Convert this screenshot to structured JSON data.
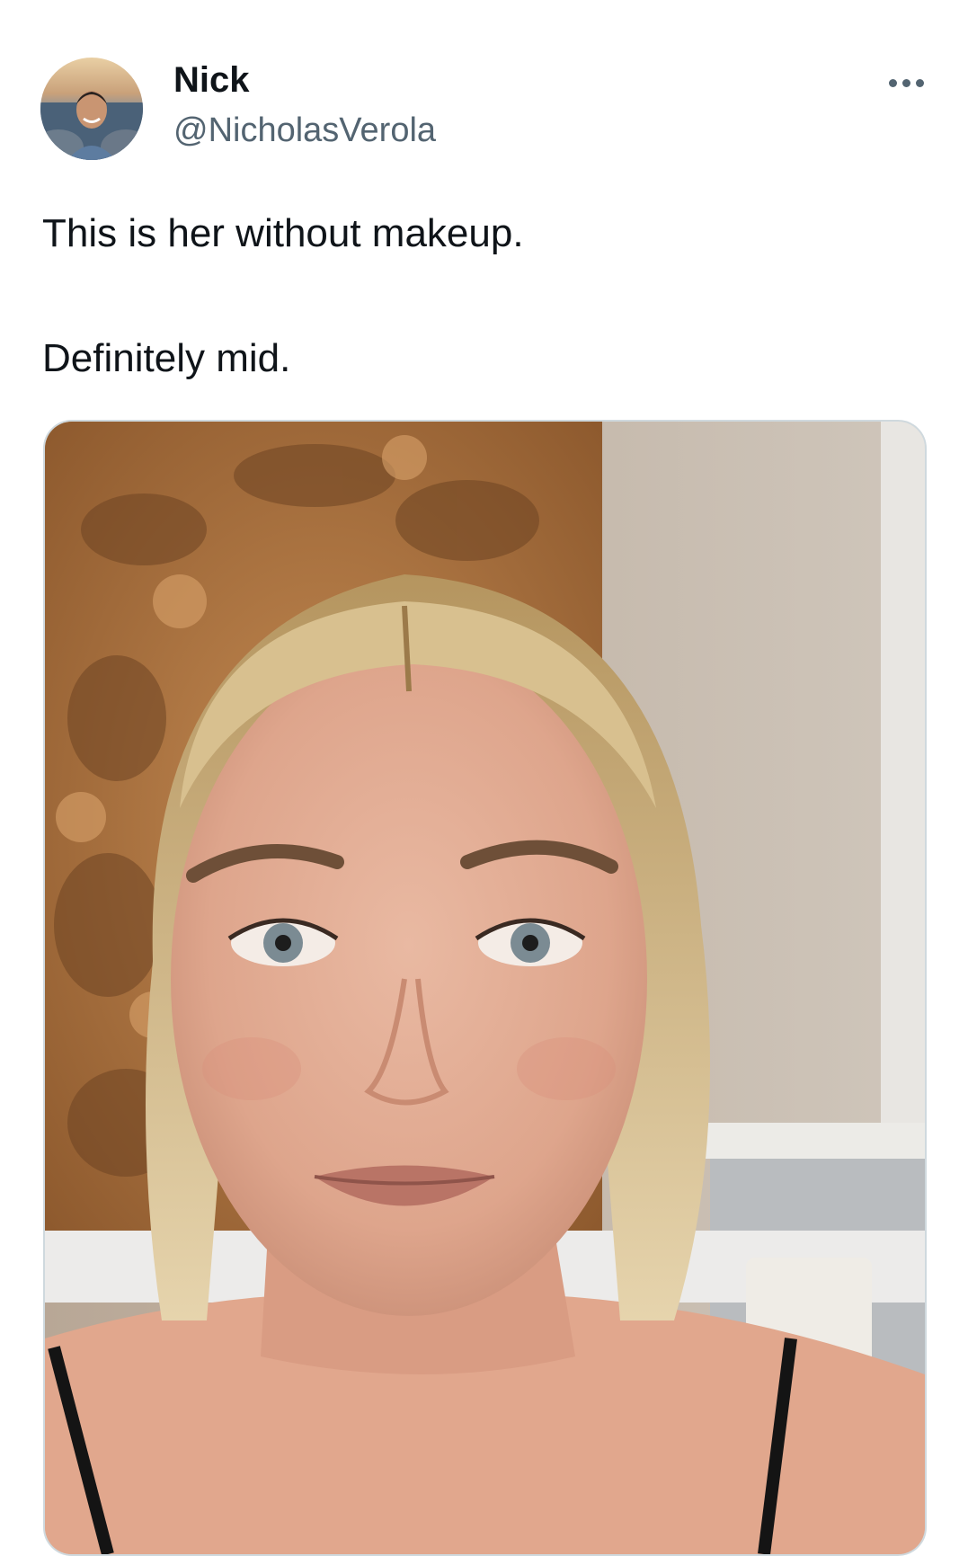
{
  "author": {
    "display_name": "Nick",
    "handle": "@NicholasVerola",
    "avatar_icon": "avatar-photo"
  },
  "menu": {
    "more_icon": "more-horizontal-icon"
  },
  "tweet": {
    "line_1": "This is her without makeup.",
    "line_2": "Definitely mid."
  },
  "media": {
    "kind": "photo"
  },
  "colors": {
    "text_primary": "#0f1419",
    "text_secondary": "#536471",
    "border": "#cfd9de"
  }
}
